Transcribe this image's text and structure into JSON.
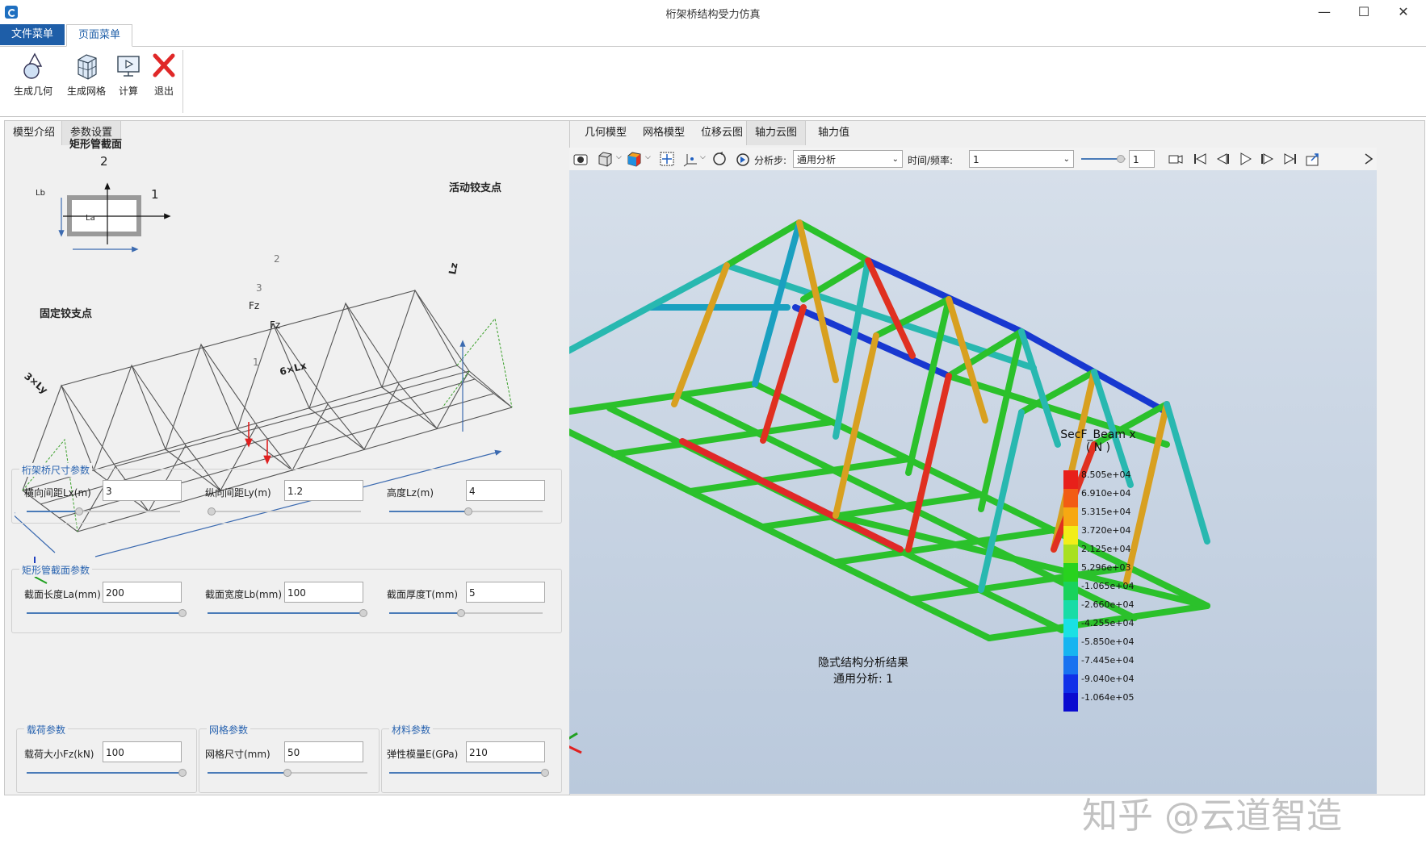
{
  "window": {
    "title": "桁架桥结构受力仿真"
  },
  "menu": {
    "file": "文件菜单",
    "page": "页面菜单"
  },
  "ribbon": {
    "gen_geometry": "生成几何",
    "gen_mesh": "生成网格",
    "compute": "计算",
    "exit": "退出"
  },
  "left_tabs": {
    "intro": "模型介绍",
    "params": "参数设置"
  },
  "diagram": {
    "section_title": "矩形管截面",
    "movable_support": "活动铰支点",
    "fixed_support": "固定铰支点",
    "axis_1": "1",
    "axis_2": "2",
    "label_la": "La",
    "label_lb": "Lb",
    "label_lz": "Lz",
    "label_fz": "Fz",
    "label_3ly": "3×Ly",
    "label_6lx": "6×Lx",
    "node_1": "1",
    "node_2": "2",
    "node_3": "3"
  },
  "groups": {
    "dims": {
      "title": "桁架桥尺寸参数",
      "fields": [
        {
          "label": "横向间距Lx(m)",
          "value": "3",
          "slider": 0.33
        },
        {
          "label": "纵向间距Ly(m)",
          "value": "1.2",
          "slider": 0.0
        },
        {
          "label": "高度Lz(m)",
          "value": "4",
          "slider": 0.5
        }
      ]
    },
    "section": {
      "title": "矩形管截面参数",
      "fields": [
        {
          "label": "截面长度La(mm)",
          "value": "200",
          "slider": 1.0
        },
        {
          "label": "截面宽度Lb(mm)",
          "value": "100",
          "slider": 1.0
        },
        {
          "label": "截面厚度T(mm)",
          "value": "5",
          "slider": 0.45
        }
      ]
    },
    "load": {
      "title": "载荷参数",
      "label": "载荷大小Fz(kN)",
      "value": "100",
      "slider": 1.0
    },
    "mesh": {
      "title": "网格参数",
      "label": "网格尺寸(mm)",
      "value": "50",
      "slider": 0.5
    },
    "material": {
      "title": "材料参数",
      "label": "弹性模量E(GPa)",
      "value": "210",
      "slider": 1.0
    }
  },
  "right_tabs": [
    "几何模型",
    "网格模型",
    "位移云图",
    "轴力云图",
    "轴力值"
  ],
  "toolbar": {
    "step_label": "分析步:",
    "step_value": "通用分析",
    "time_label": "时间/频率:",
    "time_value": "1",
    "frame_value": "1"
  },
  "legend": {
    "title": "SecF_Beam  x",
    "unit": "( N )",
    "levels": [
      {
        "label": "8.505e+04",
        "color": "#e8201a"
      },
      {
        "label": "6.910e+04",
        "color": "#f25c14"
      },
      {
        "label": "5.315e+04",
        "color": "#f7a812"
      },
      {
        "label": "3.720e+04",
        "color": "#f2ee18"
      },
      {
        "label": "2.125e+04",
        "color": "#a8e020"
      },
      {
        "label": "5.296e+03",
        "color": "#28d21e"
      },
      {
        "label": "-1.065e+04",
        "color": "#19d25c"
      },
      {
        "label": "-2.660e+04",
        "color": "#19dca6"
      },
      {
        "label": "-4.255e+04",
        "color": "#1ae0e4"
      },
      {
        "label": "-5.850e+04",
        "color": "#16b4f0"
      },
      {
        "label": "-7.445e+04",
        "color": "#1872f0"
      },
      {
        "label": "-9.040e+04",
        "color": "#1030e8"
      },
      {
        "label": "-1.064e+05",
        "color": "#0a0ad0"
      }
    ]
  },
  "result": {
    "title": "隐式结构分析结果",
    "subtitle": "通用分析: 1"
  },
  "watermark": "知乎 @云道智造"
}
